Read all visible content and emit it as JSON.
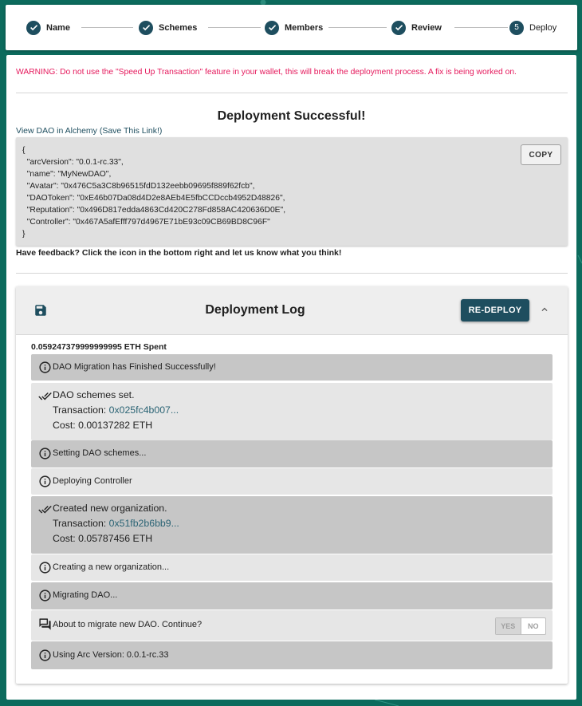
{
  "stepper": {
    "steps": [
      {
        "label": "Name",
        "state": "done"
      },
      {
        "label": "Schemes",
        "state": "done"
      },
      {
        "label": "Members",
        "state": "done"
      },
      {
        "label": "Review",
        "state": "done"
      },
      {
        "label": "Deploy",
        "state": "active",
        "number": "5"
      }
    ]
  },
  "warning": "WARNING: Do not use the \"Speed Up Transaction\" feature in your wallet, this will break the deployment process. A fix is being worked on.",
  "success": {
    "title": "Deployment Successful!",
    "view_link": "View DAO in Alchemy (Save This Link!)",
    "json_lines": [
      "{",
      "  \"arcVersion\": \"0.0.1-rc.33\",",
      "  \"name\": \"MyNewDAO\",",
      "  \"Avatar\": \"0x476C5a3C8b96515fdD132eebb09695f889f62fcb\",",
      "  \"DAOToken\": \"0xE46b07Da08d4D2e8AEb4E5fbCCDccb4952D48826\",",
      "  \"Reputation\": \"0x496D817edda4863Cd420C278Fd858AC420636D0E\",",
      "  \"Controller\": \"0x467A5afEfff797d4967E71bE93c09CB69BD8C96F\"",
      "}"
    ],
    "copy_label": "COPY",
    "feedback": "Have feedback? Click the icon in the bottom right and let us know what you think!"
  },
  "log": {
    "title": "Deployment Log",
    "redeploy_label": "RE-DEPLOY",
    "eth_spent": "0.059247379999999995 ETH Spent",
    "entries": [
      {
        "icon": "info-icon",
        "text": "DAO Migration has Finished Successfully!"
      },
      {
        "icon": "check-icon",
        "title": "DAO schemes set.",
        "tx_label": "Transaction: ",
        "tx": "0x025fc4b007...",
        "cost": "Cost: 0.00137282 ETH"
      },
      {
        "icon": "info-icon",
        "text": "Setting DAO schemes..."
      },
      {
        "icon": "info-icon",
        "text": "Deploying Controller"
      },
      {
        "icon": "check-icon",
        "title": "Created new organization.",
        "tx_label": "Transaction: ",
        "tx": "0x51fb2b6bb9...",
        "cost": "Cost: 0.05787456 ETH"
      },
      {
        "icon": "info-icon",
        "text": "Creating a new organization..."
      },
      {
        "icon": "info-icon",
        "text": "Migrating DAO..."
      },
      {
        "icon": "question-answer-icon",
        "text": "About to migrate new DAO. Continue?",
        "yes": "YES",
        "no": "NO"
      },
      {
        "icon": "info-icon",
        "text": "Using Arc Version: 0.0.1-rc.33"
      }
    ]
  }
}
